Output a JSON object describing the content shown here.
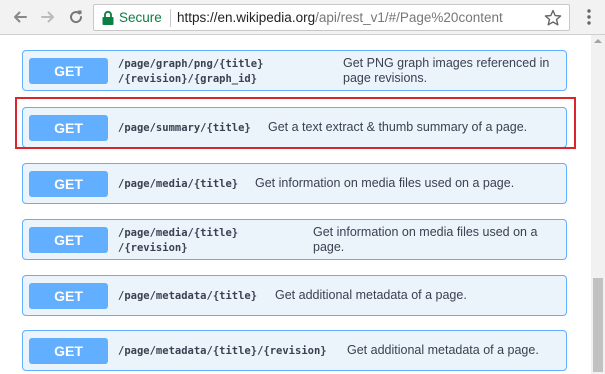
{
  "browser": {
    "secure_label": "Secure",
    "url_main": "https://en.wikipedia.org",
    "url_rest": "/api/rest_v1/#/Page%20content",
    "icons": [
      "back-icon",
      "forward-icon",
      "reload-icon",
      "lock-icon",
      "star-icon",
      "menu-icon"
    ]
  },
  "operations": [
    {
      "method": "GET",
      "path": "/page/graph/png/{title}\n/{revision}/{graph_id}",
      "description": "Get PNG graph images referenced in page revisions."
    },
    {
      "method": "GET",
      "path": "/page/summary/{title}",
      "description": "Get a text extract & thumb summary of a page.",
      "highlighted": true
    },
    {
      "method": "GET",
      "path": "/page/media/{title}",
      "description": "Get information on media files used on a page."
    },
    {
      "method": "GET",
      "path": "/page/media/{title}\n/{revision}",
      "description": "Get information on media files used on a page."
    },
    {
      "method": "GET",
      "path": "/page/metadata/{title}",
      "description": "Get additional metadata of a page."
    },
    {
      "method": "GET",
      "path": "/page/metadata/{title}/{revision}",
      "description": "Get additional metadata of a page."
    }
  ],
  "colors": {
    "get_accent": "#61affe",
    "get_background": "#ebf3fb",
    "highlight_border": "#d9252b",
    "secure_green": "#0b8043"
  }
}
